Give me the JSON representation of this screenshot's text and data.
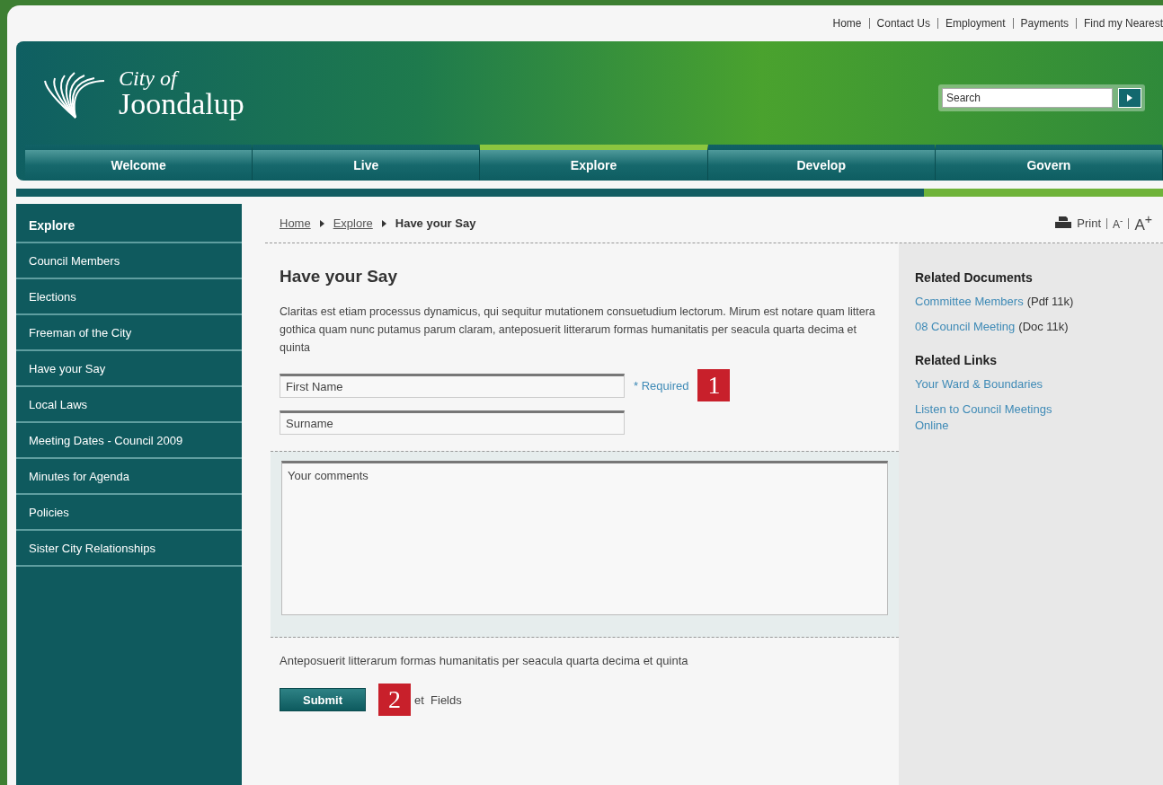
{
  "top_links": [
    "Home",
    "Contact Us",
    "Employment",
    "Payments",
    "Find my Nearest"
  ],
  "logo": {
    "line1": "City of",
    "line2": "Joondalup"
  },
  "search": {
    "placeholder": "Search"
  },
  "nav": [
    {
      "label": "Welcome",
      "selected": false
    },
    {
      "label": "Live",
      "selected": false
    },
    {
      "label": "Explore",
      "selected": true
    },
    {
      "label": "Develop",
      "selected": false
    },
    {
      "label": "Govern",
      "selected": false
    }
  ],
  "sidebar": {
    "title": "Explore",
    "items": [
      "Council Members",
      "Elections",
      "Freeman of the City",
      "Have your Say",
      "Local Laws",
      "Meeting Dates - Council 2009",
      "Minutes for Agenda",
      "Policies",
      "Sister City Relationships"
    ]
  },
  "breadcrumb": [
    "Home",
    "Explore",
    "Have your Say"
  ],
  "tools": {
    "print": "Print",
    "smaller": "A$^{-}$",
    "larger": "A$^{+}$"
  },
  "content": {
    "title": "Have your Say",
    "intro": "Claritas est etiam processus dynamicus, qui sequitur mutationem consuetudium lectorum. Mirum est notare quam littera gothica quam nunc putamus parum claram, anteposuerit litterarum formas humanitatis per seacula quarta decima et quinta",
    "fields": [
      {
        "placeholder": "First Name",
        "required": "* Required"
      },
      {
        "placeholder": "Surname"
      }
    ],
    "comments": {
      "placeholder": "Your comments"
    },
    "note": "Anteposuerit litterarum formas humanitatis per seacula quarta decima et quinta",
    "submit": "Submit",
    "reset": "et  Fields"
  },
  "annotations": [
    "1",
    "2"
  ],
  "related_documents": {
    "title": "Related Documents",
    "items": [
      {
        "link": "Committee Members",
        "meta": "(Pdf 11k)"
      },
      {
        "link": "08 Council Meeting",
        "meta": "(Doc 11k)"
      }
    ]
  },
  "related_links": {
    "title": "Related Links",
    "items": [
      "Your Ward & Boundaries",
      "Listen to Council Meetings Online"
    ]
  }
}
